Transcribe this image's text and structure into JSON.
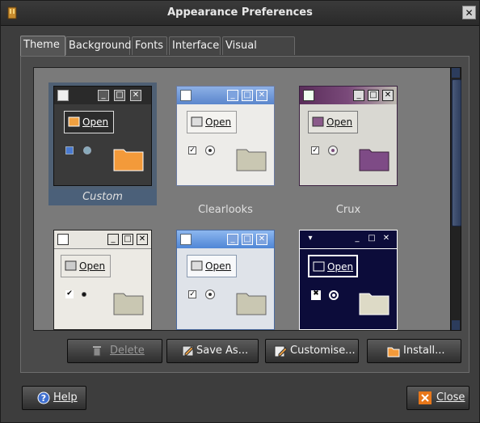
{
  "window": {
    "title": "Appearance Preferences",
    "close_glyph": "✕"
  },
  "tabs": [
    {
      "label": "Theme",
      "active": true
    },
    {
      "label": "Background"
    },
    {
      "label": "Fonts"
    },
    {
      "label": "Interface"
    },
    {
      "label": "Visual Effects"
    }
  ],
  "themes": [
    {
      "name": "Custom",
      "open_label": "Open",
      "selected": true
    },
    {
      "name": "Clearlooks",
      "open_label": "Open"
    },
    {
      "name": "Crux",
      "open_label": "Open"
    },
    {
      "name": "",
      "open_label": "Open"
    },
    {
      "name": "",
      "open_label": "Open"
    },
    {
      "name": "",
      "open_label": "Open"
    }
  ],
  "actions": {
    "delete": {
      "label": "Delete",
      "icon": "trash-icon",
      "enabled": false
    },
    "save_as": {
      "label": "Save As...",
      "icon": "save-as-icon"
    },
    "customise": {
      "label": "Customise...",
      "icon": "customise-icon"
    },
    "install": {
      "label": "Install...",
      "icon": "install-icon"
    }
  },
  "footer": {
    "help": {
      "label": "Help",
      "icon": "help-icon"
    },
    "close": {
      "label": "Close",
      "icon": "close-icon"
    }
  },
  "colors": {
    "accent": "#4b6079",
    "close_icon": "#e8771a",
    "help_icon": "#3f6fcf"
  }
}
